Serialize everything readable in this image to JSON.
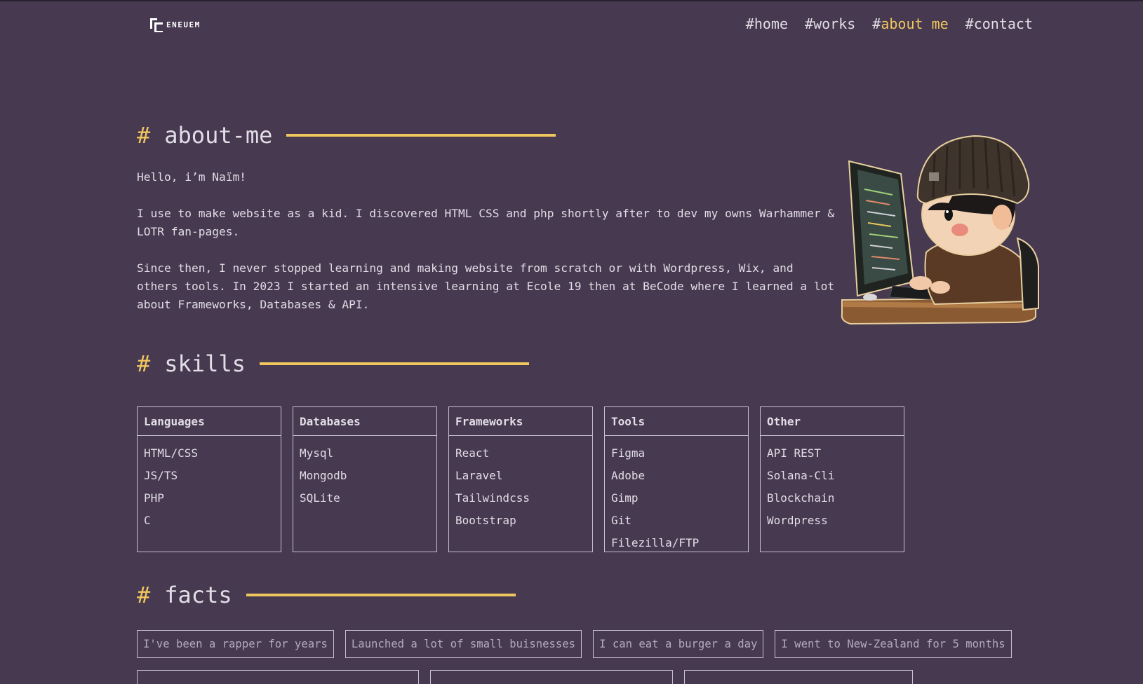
{
  "brand": {
    "logo_text": "ENEUEM"
  },
  "nav": [
    {
      "hash": "#",
      "label": "home",
      "active": false
    },
    {
      "hash": "#",
      "label": "works",
      "active": false
    },
    {
      "hash": "#",
      "label": "about me",
      "active": true
    },
    {
      "hash": "#",
      "label": "contact",
      "active": false
    }
  ],
  "about": {
    "hash": "#",
    "title": "about-me",
    "paragraphs": [
      "Hello, i’m Naïm!",
      "I use to make website as a kid. I discovered HTML CSS and php shortly after to dev my owns Warhammer & LOTR fan-pages.",
      "Since then, I never stopped learning and making website from scratch or with Wordpress, Wix, and others tools. In 2023 I started an intensive learning at Ecole 19 then at BeCode where I learned a lot about Frameworks, Databases & API."
    ]
  },
  "skills": {
    "hash": "#",
    "title": "skills",
    "groups": [
      {
        "name": "Languages",
        "items": [
          "HTML/CSS",
          "JS/TS",
          "PHP",
          "C"
        ]
      },
      {
        "name": "Databases",
        "items": [
          "Mysql",
          "Mongodb",
          "SQLite"
        ]
      },
      {
        "name": "Frameworks",
        "items": [
          "React",
          "Laravel",
          "Tailwindcss",
          "Bootstrap"
        ]
      },
      {
        "name": "Tools",
        "items": [
          "Figma",
          "Adobe",
          "Gimp",
          "Git",
          "Filezilla/FTP"
        ]
      },
      {
        "name": "Other",
        "items": [
          "API REST",
          "Solana-Cli",
          "Blockchain",
          "Wordpress"
        ]
      }
    ]
  },
  "facts": {
    "hash": "#",
    "title": "facts",
    "items": [
      "I've been a rapper for years",
      "Launched a lot of small buisnesses",
      "I can eat a burger a day",
      "I went to New-Zealand for 5 months"
    ]
  },
  "colors": {
    "background": "#463950",
    "accent": "#f0c75e",
    "text": "#e2dde6",
    "border": "#c9c1cf"
  }
}
